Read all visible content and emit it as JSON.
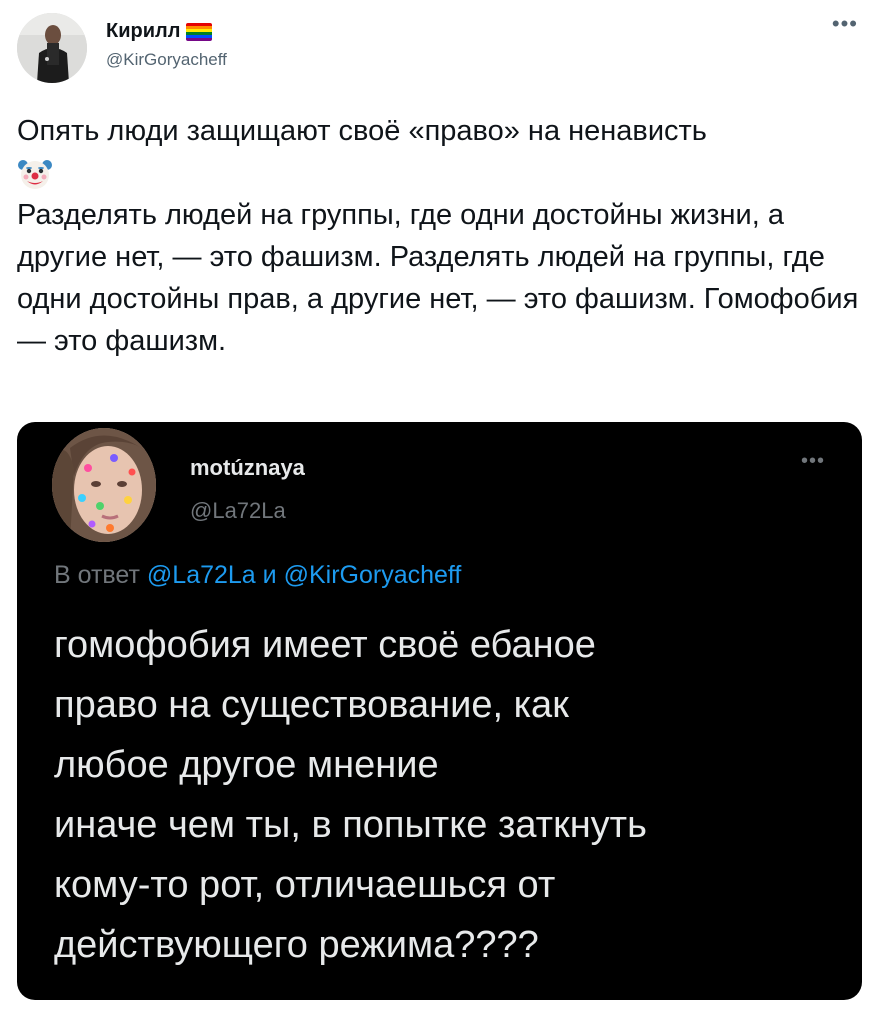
{
  "author": {
    "display_name": "Кирилл",
    "handle": "@KirGoryacheff",
    "badge_icon": "rainbow-flag-icon"
  },
  "more_icon": "•••",
  "tweet": {
    "line1": "Опять люди защищают своё «право» на ненависть",
    "emoji": "clown-face-icon",
    "line2": "Разделять людей на группы, где одни достойны жизни, а другие нет, — это фашизм. Разделять людей на группы, где одни достойны прав, а другие нет, — это фашизм. Гомофобия — это фашизм."
  },
  "quoted": {
    "display_name": "motúznaya",
    "handle": "@La72La",
    "more": "•••",
    "reply_prefix": "В ответ",
    "reply_mention_1": "@La72La",
    "reply_conj": "и",
    "reply_mention_2": "@KirGoryacheff",
    "lines": [
      "гомофобия имеет своё ебаное",
      "право на существование, как",
      "любое другое мнение",
      "иначе чем ты, в попытке заткнуть",
      "кому-то рот, отличаешься от",
      "действующего режима????"
    ]
  },
  "colors": {
    "text": "#0f1419",
    "secondary": "#536471",
    "card_bg": "#000000",
    "card_text": "#e7e9ea",
    "card_secondary": "#71767b",
    "link": "#1d9bf0"
  }
}
